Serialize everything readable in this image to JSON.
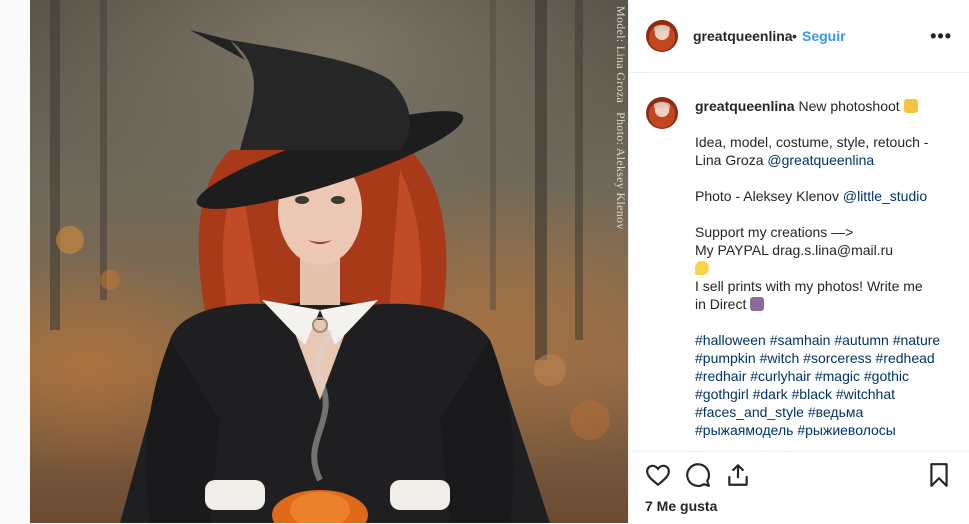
{
  "header": {
    "username": "greatqueenlina",
    "dot": "•",
    "follow_label": "Seguir",
    "more_label": "•••"
  },
  "photo": {
    "credit_model": "Model: Lina Groza",
    "credit_photo": "Photo: Aleksey Klenov"
  },
  "caption": {
    "username": "greatqueenlina",
    "line1": "New photoshoot",
    "line2": "Idea, model, costume, style, retouch -",
    "line3_text": "Lina Groza ",
    "line3_mention": "@greatqueenlina",
    "line4_text": "Photo - Aleksey Klenov ",
    "line4_mention": "@little_studio",
    "line5": "Support my creations —>",
    "line6": "My PAYPAL drag.s.lina@mail.ru",
    "line7": "I sell prints with my photos! Write me",
    "line8": "in Direct",
    "hashtags": [
      "#halloween",
      "#samhain",
      "#autumn",
      "#nature",
      "#pumpkin",
      "#witch",
      "#sorceress",
      "#redhead",
      "#redhair",
      "#curlyhair",
      "#magic",
      "#gothic",
      "#gothgirl",
      "#dark",
      "#black",
      "#witchhat",
      "#faces_and_style",
      "#ведьма",
      "#рыжаямодель",
      "#рыжиеволосы"
    ]
  },
  "actions": {
    "icons": [
      "heart-icon",
      "comment-icon",
      "share-icon",
      "bookmark-icon"
    ],
    "likes_label": "7 Me gusta"
  },
  "colors": {
    "link": "#3897f0",
    "hashtag": "#003569",
    "text": "#262626"
  }
}
